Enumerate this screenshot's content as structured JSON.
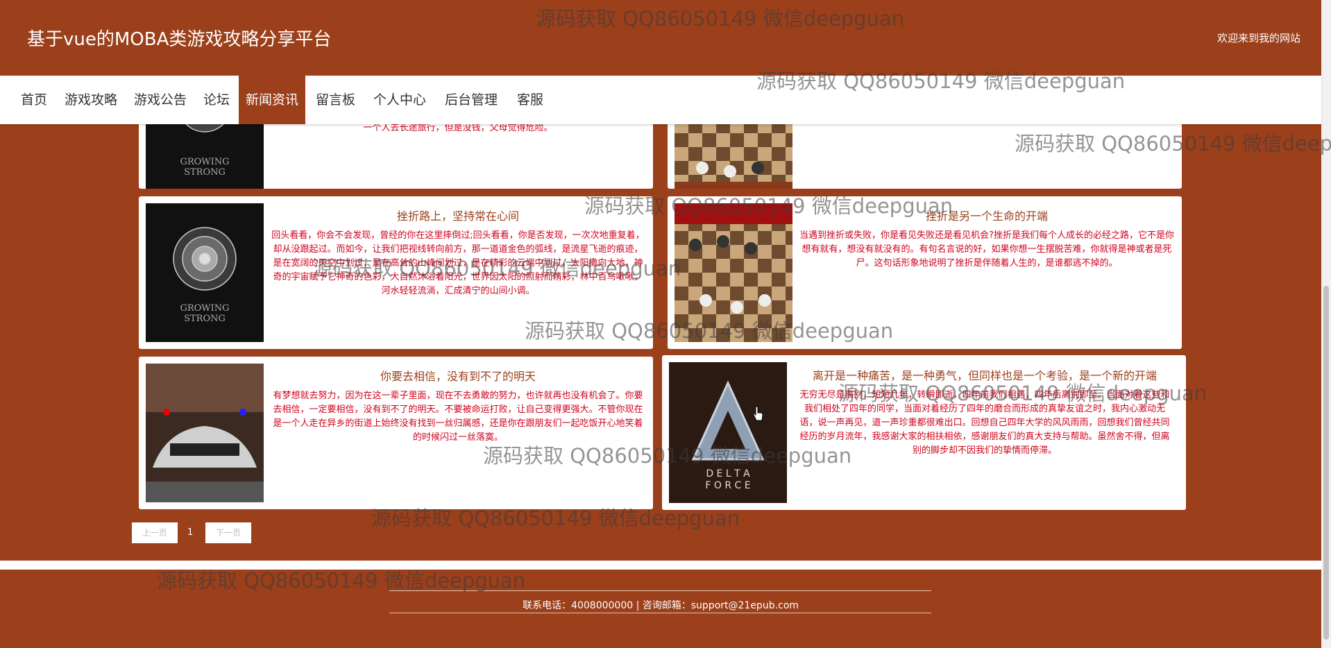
{
  "header": {
    "title": "基于vue的MOBA类游戏攻略分享平台",
    "welcome": "欢迎来到我的网站"
  },
  "nav": {
    "items": [
      "首页",
      "游戏攻略",
      "游戏公告",
      "论坛",
      "新闻资讯",
      "留言板",
      "个人中心",
      "后台管理",
      "客服"
    ],
    "active": "新闻资讯"
  },
  "news": [
    {
      "title": "",
      "summary": "一个人去长途旅行，但是没钱，父母觉得危险。",
      "image": "growing-strong-poster"
    },
    {
      "title": "",
      "summary": "",
      "image": "chess-board"
    },
    {
      "title": "挫折路上，坚持常在心间",
      "summary": "回头看看，你会不会发现，曾经的你在这里摔倒过;回头看看，你是否发现，一次次地重复着，却从没跟起过。而如今，让我们把视线转向前方，那一道道金色的弧线，是流星飞逝的痕迹，是在宽阔的天空中划过，是在高耸的山峰间划过，是在精彩的云端中划过，太阳撒向大地，神奇的宇宙赋予它神奇的色彩，大自然沐浴着阳光，世界因太阳的照射而精彩，林中百鸟啾啾，河水轻轻流淌，汇成清宁的山间小调。",
      "image": "growing-strong-poster"
    },
    {
      "title": "挫折是另一个生命的开端",
      "summary": "当遇到挫折或失败，你是看见失败还是看见机会?挫折是我们每个人成长的必经之路，它不是你想有就有，想没有就没有的。有句名言说的好，如果你想一生摆脱苦难，你就得是神或者是死尸。这句话形象地说明了挫折是伴随着人生的，是谁都逃不掉的。",
      "image": "chess-board"
    },
    {
      "title": "你要去相信，没有到不了的明天",
      "summary": "有梦想就去努力，因为在这一辈子里面，现在不去勇敢的努力，也许就再也没有机会了。你要去相信，一定要相信，没有到不了的明天。不要被命运打败，让自己变得更强大。不管你现在是一个人走在异乡的街道上始终没有找到一丝归属感，还是你在跟朋友们一起吃饭开心地笑着的时候闪过一丝落寞。",
      "image": "police-sports-car"
    },
    {
      "title": "离开是一种痛苦，是一种勇气，但同样也是一个考验，是一个新的开端",
      "summary": "无穷无尽是离别，短短几年，转瞬即逝，四年前我们相遇，四年后离别即至。当面对着这些和我们相处了四年的同学，当面对着经历了四年的磨合而形成的真挚友谊之时，我内心激动无语，说一声再见，道一声珍重都很难出口。回想自己四年大学的风风雨雨，回想我们曾经共同经历的岁月流年，我感谢大家的相扶相依，感谢朋友们的真大支持与帮助。虽然舍不得，但离别的脚步却不因我们的挚情而停滞。",
      "image": "delta-force-cover"
    }
  ],
  "pager": {
    "prev": "上一页",
    "current": "1",
    "next": "下一页"
  },
  "footer": {
    "contact": "联系电话：4008000000 | 咨询邮箱：support@21epub.com"
  },
  "watermark": "源码获取 QQ86050149 微信deepguan",
  "colors": {
    "brand": "#9c3f1b",
    "summary_text": "#d0021b",
    "title_text": "#9c3f1b"
  }
}
